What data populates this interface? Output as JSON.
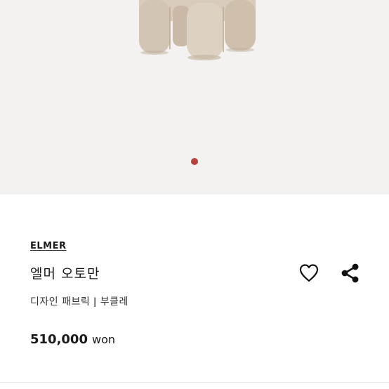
{
  "gallery": {
    "image_name": "elmer-ottoman-photo",
    "image_count_visible": 1,
    "active_dot_color": "#b5423c"
  },
  "product": {
    "brand": "ELMER",
    "title": "엘머 오토만",
    "subtitle": "디자인 패브릭 ǀ 부클레",
    "price": "510,000",
    "price_unit": "won"
  },
  "actions": {
    "favorite_icon": "heart-icon",
    "share_icon": "share-icon"
  }
}
